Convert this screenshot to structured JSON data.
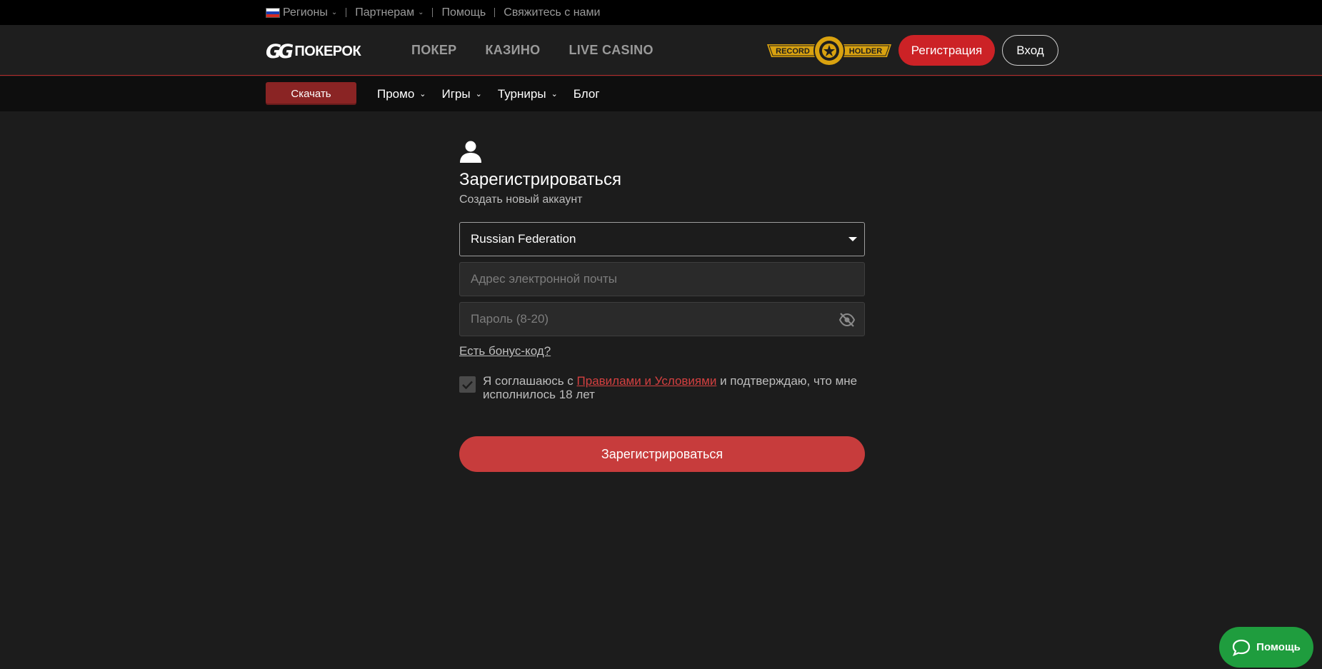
{
  "topbar": {
    "regions": "Регионы",
    "partners": "Партнерам",
    "help": "Помощь",
    "contact": "Свяжитесь с нами"
  },
  "header": {
    "logo_text": "ПОКЕРОК",
    "nav": [
      "ПОКЕР",
      "КАЗИНО",
      "LIVE CASINO"
    ],
    "badge_left": "RECORD",
    "badge_right": "HOLDER",
    "register": "Регистрация",
    "login": "Вход"
  },
  "subnav": {
    "download": "Скачать",
    "items": [
      "Промо",
      "Игры",
      "Турниры",
      "Блог"
    ]
  },
  "form": {
    "title": "Зарегистрироваться",
    "subtitle": "Создать новый аккаунт",
    "country": "Russian Federation",
    "email_placeholder": "Адрес электронной почты",
    "password_placeholder": "Пароль (8-20)",
    "bonus_link": "Есть бонус-код?",
    "agree_prefix": "Я соглашаюсь с",
    "agree_link": "Правилами и Условиями",
    "agree_suffix": "и подтверждаю, что мне исполнилось 18 лет",
    "agree_checked": true,
    "submit": "Зарегистрироваться"
  },
  "help_button": "Помощь",
  "colors": {
    "accent_red": "#cc2226",
    "help_green": "#1f9d3e",
    "background": "#1c1c1c"
  }
}
